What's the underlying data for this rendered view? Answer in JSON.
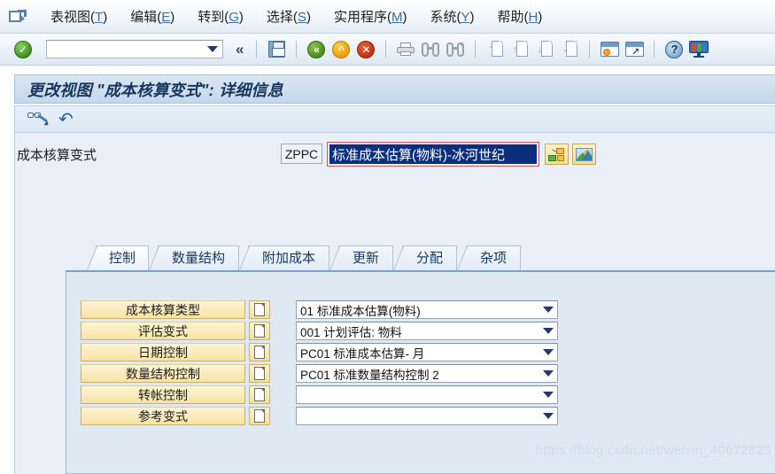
{
  "menubar": {
    "system_menu_icon": "system-menu-icon",
    "items": [
      {
        "label": "表视图",
        "accesskey": "T"
      },
      {
        "label": "编辑",
        "accesskey": "E"
      },
      {
        "label": "转到",
        "accesskey": "G"
      },
      {
        "label": "选择",
        "accesskey": "S"
      },
      {
        "label": "实用程序",
        "accesskey": "M"
      },
      {
        "label": "系统",
        "accesskey": "Y"
      },
      {
        "label": "帮助",
        "accesskey": "H"
      }
    ]
  },
  "toolbar": {
    "enter_icon": "green-check-enter-icon",
    "command_field_value": "",
    "command_field_placeholder": "",
    "collapse_icon": "double-chevron-left-icon",
    "save_icon": "save-disk-icon",
    "back_icon": "back-green-icon",
    "exit_icon": "exit-up-amber-icon",
    "cancel_icon": "cancel-red-x-icon",
    "print_icon": "print-icon",
    "find_icon": "find-binoculars-icon",
    "find_next_icon": "find-next-binoculars-icon",
    "first_page_icon": "first-page-icon",
    "previous_page_icon": "previous-page-icon",
    "next_page_icon": "next-page-icon",
    "last_page_icon": "last-page-icon",
    "create_session_icon": "create-session-icon",
    "create_shortcut_icon": "create-shortcut-icon",
    "help_icon": "help-question-icon",
    "customize_icon": "customize-local-layout-icon"
  },
  "title": "更改视图 \"成本核算变式\": 详细信息",
  "apptoolbar": {
    "display_change_icon": "display-change-glasses-icon",
    "undo_icon": "undo-arrow-icon"
  },
  "detail": {
    "label": "成本核算变式",
    "key_value": "ZPPC",
    "description_value": "标准成本估算(物料)-冰河世纪",
    "structure_button_icon": "costing-structure-icon",
    "picture_button_icon": "picture-landscape-icon"
  },
  "tabs": [
    {
      "label": "控制",
      "active": true
    },
    {
      "label": "数量结构",
      "active": false
    },
    {
      "label": "附加成本",
      "active": false
    },
    {
      "label": "更新",
      "active": false
    },
    {
      "label": "分配",
      "active": false
    },
    {
      "label": "杂项",
      "active": false
    }
  ],
  "form": {
    "rows": [
      {
        "label": "成本核算类型",
        "doc_icon": "document-icon",
        "value": "01 标准成本估算(物料)"
      },
      {
        "label": "评估变式",
        "doc_icon": "document-icon",
        "value": "001 计划评估: 物料"
      },
      {
        "label": "日期控制",
        "doc_icon": "document-icon",
        "value": "PC01 标准成本估算- 月"
      },
      {
        "label": "数量结构控制",
        "doc_icon": "document-icon",
        "value": "PC01 标准数量结构控制 2"
      },
      {
        "label": "转帐控制",
        "doc_icon": "document-icon",
        "value": ""
      },
      {
        "label": "参考变式",
        "doc_icon": "document-icon",
        "value": ""
      }
    ]
  },
  "watermark": "https://blog.csdn.net/weixin_40672823",
  "colors": {
    "accent": "#16365c",
    "field_highlight": "#0b2f7a",
    "focus_border": "#e04b4b",
    "button_yellow": "#f6e3a5",
    "panel_bg": "#dfe9f4"
  }
}
